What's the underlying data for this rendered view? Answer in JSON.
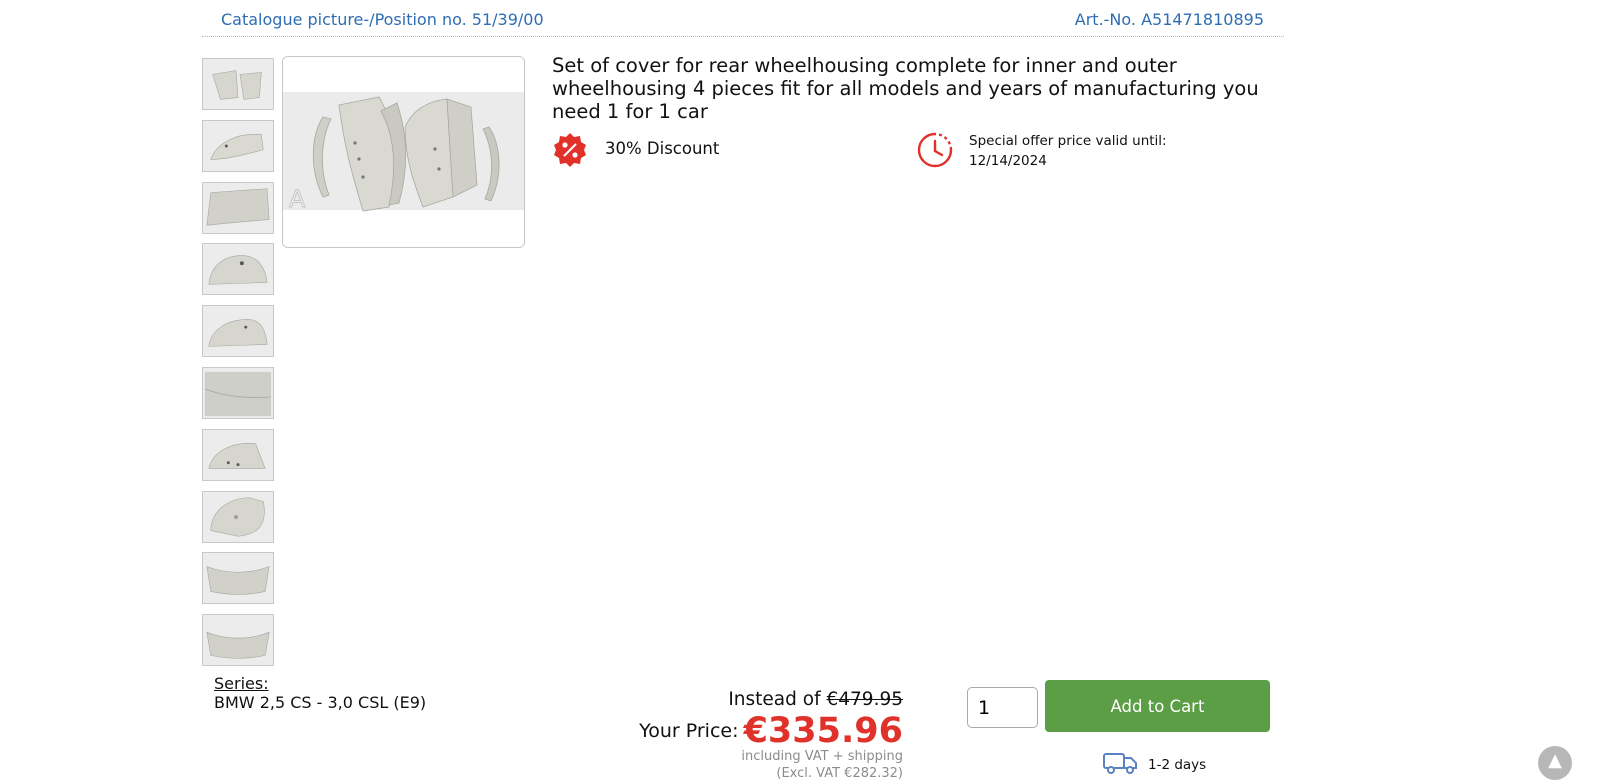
{
  "header": {
    "catalogue_position": "Catalogue picture-/Position no. 51/39/00",
    "article_number": "Art.-No. A51471810895"
  },
  "gallery": {
    "thumbnail_count": 10,
    "watermark": "A"
  },
  "product": {
    "title": "Set of cover for rear wheelhousing complete for inner and outer wheelhousing 4 pieces fit for all models and years of manufacturing you need 1 for 1 car"
  },
  "promo": {
    "discount_text": "30% Discount",
    "offer_label": "Special offer price valid until:",
    "offer_date": "12/14/2024"
  },
  "series": {
    "label": "Series:",
    "value": "BMW 2,5 CS - 3,0 CSL (E9)"
  },
  "pricing": {
    "instead_label": "Instead of",
    "old_price": "€479.95",
    "your_price_label": "Your Price:",
    "price": "€335.96",
    "vat_note": "including VAT + shipping",
    "net_note": "(Excl. VAT €282.32)"
  },
  "cart": {
    "quantity": "1",
    "button_label": "Add to Cart"
  },
  "delivery": {
    "time": "1-2 days"
  },
  "colors": {
    "link": "#2e6db4",
    "price": "#e0312a",
    "cart_button": "#5b9e45"
  }
}
